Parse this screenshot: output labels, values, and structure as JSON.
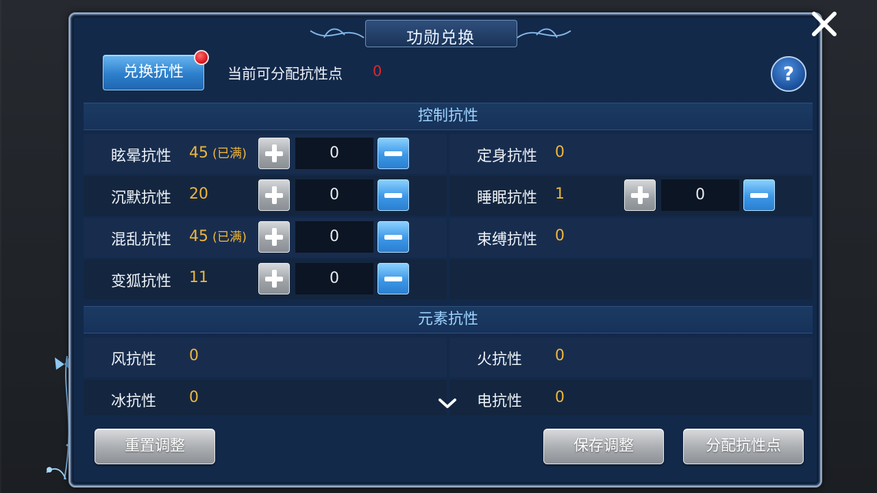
{
  "title": "功勋兑换",
  "top_bar": {
    "exchange_tab_label": "兑换抗性",
    "points_label": "当前可分配抗性点",
    "points_value": "0",
    "help_label": "?"
  },
  "control_section": {
    "header": "控制抗性",
    "items": [
      {
        "label": "眩晕抗性",
        "value": "45",
        "note": "(已满)",
        "stepper": "0"
      },
      {
        "label": "定身抗性",
        "value": "0"
      },
      {
        "label": "沉默抗性",
        "value": "20",
        "stepper": "0"
      },
      {
        "label": "睡眠抗性",
        "value": "1",
        "stepper": "0"
      },
      {
        "label": "混乱抗性",
        "value": "45",
        "note": "(已满)",
        "stepper": "0"
      },
      {
        "label": "束缚抗性",
        "value": "0"
      },
      {
        "label": "变狐抗性",
        "value": "11",
        "stepper": "0"
      }
    ]
  },
  "element_section": {
    "header": "元素抗性",
    "items": [
      {
        "label": "风抗性",
        "value": "0"
      },
      {
        "label": "火抗性",
        "value": "0"
      },
      {
        "label": "冰抗性",
        "value": "0"
      },
      {
        "label": "电抗性",
        "value": "0"
      }
    ]
  },
  "buttons": {
    "reset": "重置调整",
    "save": "保存调整",
    "allocate": "分配抗性点"
  },
  "icons": [
    "close-icon",
    "help-icon",
    "plus-icon",
    "minus-icon",
    "chevron-down-icon",
    "butterfly-decoration"
  ],
  "colors": {
    "value_gold": "#f0b63c",
    "points_red": "#e1252a",
    "header_cyan": "#9fd4ff",
    "panel_navy": "#13294a"
  }
}
